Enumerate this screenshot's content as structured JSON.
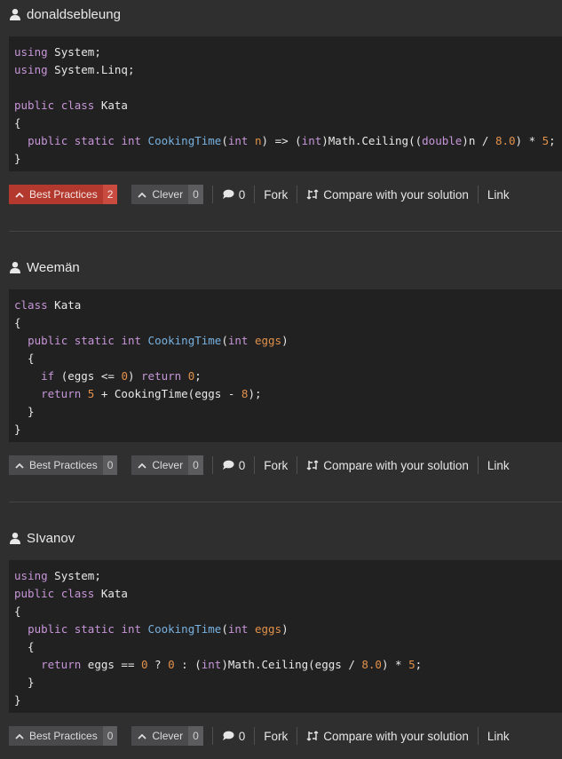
{
  "solutions": [
    {
      "author": "donaldsebleung",
      "code_lines": [
        [
          [
            "kw",
            "using"
          ],
          [
            "plain",
            " System;"
          ]
        ],
        [
          [
            "kw",
            "using"
          ],
          [
            "plain",
            " System.Linq;"
          ]
        ],
        [],
        [
          [
            "kw",
            "public"
          ],
          [
            "plain",
            " "
          ],
          [
            "kw",
            "class"
          ],
          [
            "plain",
            " Kata"
          ]
        ],
        [
          [
            "plain",
            "{"
          ]
        ],
        [
          [
            "plain",
            "  "
          ],
          [
            "kw",
            "public"
          ],
          [
            "plain",
            " "
          ],
          [
            "kw",
            "static"
          ],
          [
            "plain",
            " "
          ],
          [
            "kw",
            "int"
          ],
          [
            "plain",
            " "
          ],
          [
            "fn",
            "CookingTime"
          ],
          [
            "plain",
            "("
          ],
          [
            "kw",
            "int"
          ],
          [
            "plain",
            " "
          ],
          [
            "par",
            "n"
          ],
          [
            "plain",
            ") => ("
          ],
          [
            "kw",
            "int"
          ],
          [
            "plain",
            ")Math.Ceiling(("
          ],
          [
            "kw",
            "double"
          ],
          [
            "plain",
            ")n / "
          ],
          [
            "num",
            "8.0"
          ],
          [
            "plain",
            ") * "
          ],
          [
            "num",
            "5"
          ],
          [
            "plain",
            ";"
          ]
        ],
        [
          [
            "plain",
            "}"
          ]
        ]
      ],
      "best_practices": {
        "label": "Best Practices",
        "count": "2",
        "active": true
      },
      "clever": {
        "label": "Clever",
        "count": "0"
      },
      "comments": "0",
      "fork": "Fork",
      "compare": "Compare with your solution",
      "link": "Link"
    },
    {
      "author": "Weemän",
      "code_lines": [
        [
          [
            "kw",
            "class"
          ],
          [
            "plain",
            " Kata"
          ]
        ],
        [
          [
            "plain",
            "{"
          ]
        ],
        [
          [
            "plain",
            "  "
          ],
          [
            "kw",
            "public"
          ],
          [
            "plain",
            " "
          ],
          [
            "kw",
            "static"
          ],
          [
            "plain",
            " "
          ],
          [
            "kw",
            "int"
          ],
          [
            "plain",
            " "
          ],
          [
            "fn",
            "CookingTime"
          ],
          [
            "plain",
            "("
          ],
          [
            "kw",
            "int"
          ],
          [
            "plain",
            " "
          ],
          [
            "par",
            "eggs"
          ],
          [
            "plain",
            ")"
          ]
        ],
        [
          [
            "plain",
            "  {"
          ]
        ],
        [
          [
            "plain",
            "    "
          ],
          [
            "kw",
            "if"
          ],
          [
            "plain",
            " (eggs <= "
          ],
          [
            "num",
            "0"
          ],
          [
            "plain",
            ") "
          ],
          [
            "kw",
            "return"
          ],
          [
            "plain",
            " "
          ],
          [
            "num",
            "0"
          ],
          [
            "plain",
            ";"
          ]
        ],
        [
          [
            "plain",
            "    "
          ],
          [
            "kw",
            "return"
          ],
          [
            "plain",
            " "
          ],
          [
            "num",
            "5"
          ],
          [
            "plain",
            " + CookingTime(eggs - "
          ],
          [
            "num",
            "8"
          ],
          [
            "plain",
            ");"
          ]
        ],
        [
          [
            "plain",
            "  }"
          ]
        ],
        [
          [
            "plain",
            "}"
          ]
        ]
      ],
      "best_practices": {
        "label": "Best Practices",
        "count": "0",
        "active": false
      },
      "clever": {
        "label": "Clever",
        "count": "0"
      },
      "comments": "0",
      "fork": "Fork",
      "compare": "Compare with your solution",
      "link": "Link"
    },
    {
      "author": "SIvanov",
      "code_lines": [
        [
          [
            "kw",
            "using"
          ],
          [
            "plain",
            " System;"
          ]
        ],
        [
          [
            "kw",
            "public"
          ],
          [
            "plain",
            " "
          ],
          [
            "kw",
            "class"
          ],
          [
            "plain",
            " Kata"
          ]
        ],
        [
          [
            "plain",
            "{"
          ]
        ],
        [
          [
            "plain",
            "  "
          ],
          [
            "kw",
            "public"
          ],
          [
            "plain",
            " "
          ],
          [
            "kw",
            "static"
          ],
          [
            "plain",
            " "
          ],
          [
            "kw",
            "int"
          ],
          [
            "plain",
            " "
          ],
          [
            "fn",
            "CookingTime"
          ],
          [
            "plain",
            "("
          ],
          [
            "kw",
            "int"
          ],
          [
            "plain",
            " "
          ],
          [
            "par",
            "eggs"
          ],
          [
            "plain",
            ")"
          ]
        ],
        [
          [
            "plain",
            "  {"
          ]
        ],
        [
          [
            "plain",
            "    "
          ],
          [
            "kw",
            "return"
          ],
          [
            "plain",
            " eggs == "
          ],
          [
            "num",
            "0"
          ],
          [
            "plain",
            " ? "
          ],
          [
            "num",
            "0"
          ],
          [
            "plain",
            " : ("
          ],
          [
            "kw",
            "int"
          ],
          [
            "plain",
            ")Math.Ceiling(eggs / "
          ],
          [
            "num",
            "8.0"
          ],
          [
            "plain",
            ") * "
          ],
          [
            "num",
            "5"
          ],
          [
            "plain",
            ";"
          ]
        ],
        [
          [
            "plain",
            "  }"
          ]
        ],
        [
          [
            "plain",
            "}"
          ]
        ]
      ],
      "best_practices": {
        "label": "Best Practices",
        "count": "0",
        "active": false
      },
      "clever": {
        "label": "Clever",
        "count": "0"
      },
      "comments": "0",
      "fork": "Fork",
      "compare": "Compare with your solution",
      "link": "Link"
    }
  ]
}
